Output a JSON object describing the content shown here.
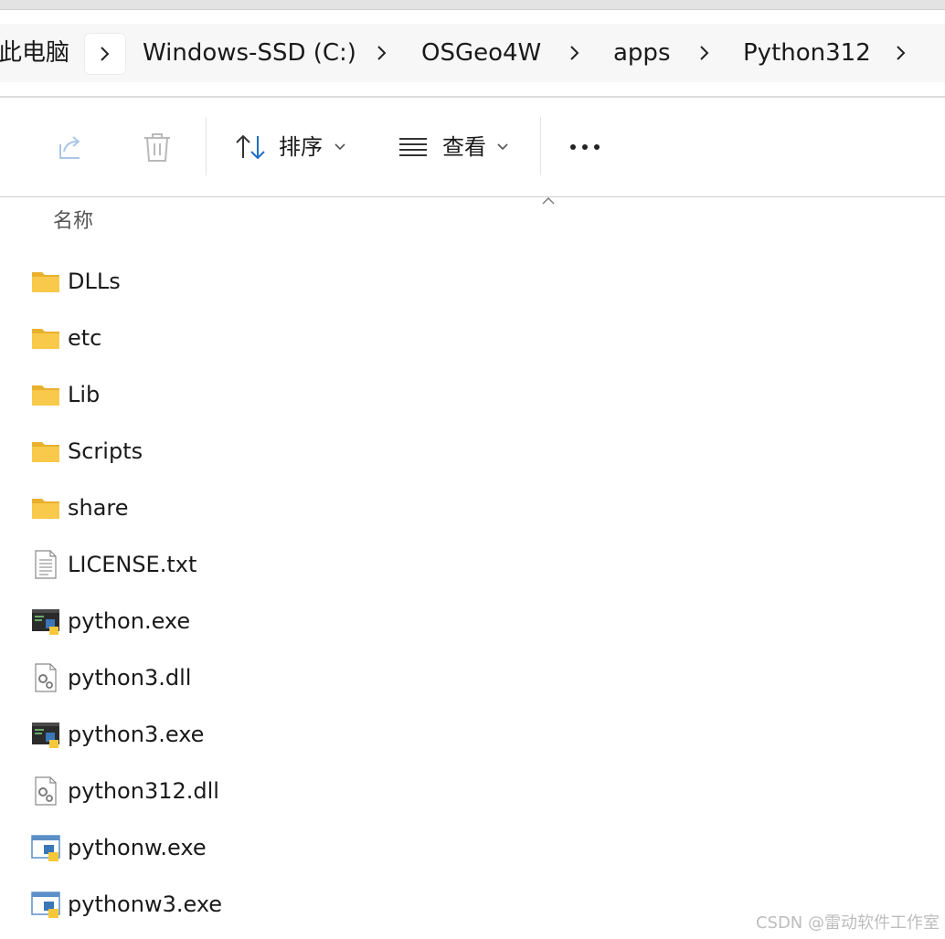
{
  "breadcrumb": {
    "items": [
      {
        "label": "此电脑"
      },
      {
        "label": "Windows-SSD (C:)"
      },
      {
        "label": "OSGeo4W"
      },
      {
        "label": "apps"
      },
      {
        "label": "Python312"
      }
    ]
  },
  "toolbar": {
    "share_icon": "share-icon",
    "delete_icon": "trash-icon",
    "sort_label": "排序",
    "view_label": "查看",
    "more_icon": "more-icon"
  },
  "columns": {
    "name_header": "名称"
  },
  "files": [
    {
      "name": "DLLs",
      "icon": "folder-icon"
    },
    {
      "name": "etc",
      "icon": "folder-icon"
    },
    {
      "name": "Lib",
      "icon": "folder-icon"
    },
    {
      "name": "Scripts",
      "icon": "folder-icon"
    },
    {
      "name": "share",
      "icon": "folder-icon"
    },
    {
      "name": "LICENSE.txt",
      "icon": "text-file-icon"
    },
    {
      "name": "python.exe",
      "icon": "python-console-icon"
    },
    {
      "name": "python3.dll",
      "icon": "dll-file-icon"
    },
    {
      "name": "python3.exe",
      "icon": "python-console-icon"
    },
    {
      "name": "python312.dll",
      "icon": "dll-file-icon"
    },
    {
      "name": "pythonw.exe",
      "icon": "python-window-icon"
    },
    {
      "name": "pythonw3.exe",
      "icon": "python-window-icon"
    }
  ],
  "watermark": "CSDN @雷动软件工作室",
  "colors": {
    "folder": "#f8c94a",
    "accent_blue": "#1d6fc1",
    "python_yellow": "#f5c83a",
    "python_blue": "#3a76b8"
  }
}
